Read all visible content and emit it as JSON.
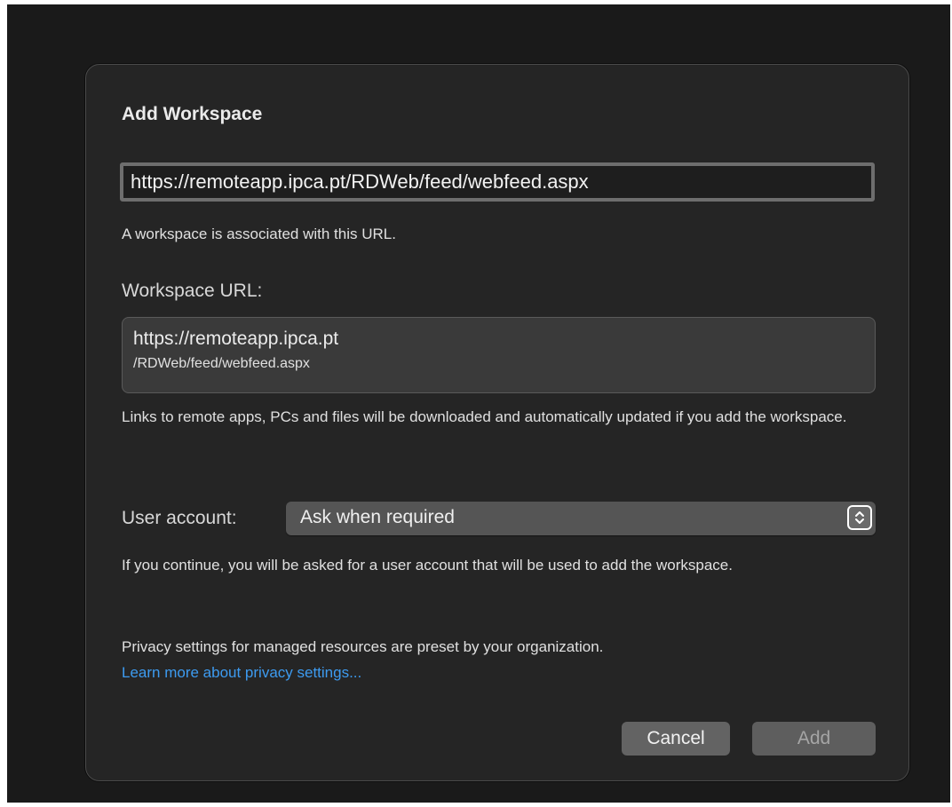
{
  "dialog": {
    "title": "Add Workspace",
    "url_input_value": "https://remoteapp.ipca.pt/RDWeb/feed/webfeed.aspx",
    "association_message": "A workspace is associated with this URL.",
    "workspace_url_label": "Workspace URL:",
    "workspace_url_host": "https://remoteapp.ipca.pt",
    "workspace_url_path": "/RDWeb/feed/webfeed.aspx",
    "links_info": "Links to remote apps, PCs and files will be downloaded and automatically updated if you add the workspace.",
    "user_account_label": "User account:",
    "user_account_selected": "Ask when required",
    "continue_info": "If you continue, you will be asked for a user account that will be used to add the workspace.",
    "privacy_info": "Privacy settings for managed resources are preset by your organization.",
    "privacy_link": "Learn more about privacy settings...",
    "cancel_label": "Cancel",
    "add_label": "Add"
  },
  "icons": {
    "select_stepper": "chevron-up-down-icon"
  },
  "colors": {
    "dialog_background": "#252525",
    "link": "#3d9bf0",
    "button": "#636363",
    "disabled_button_text": "#a5a5a5"
  }
}
